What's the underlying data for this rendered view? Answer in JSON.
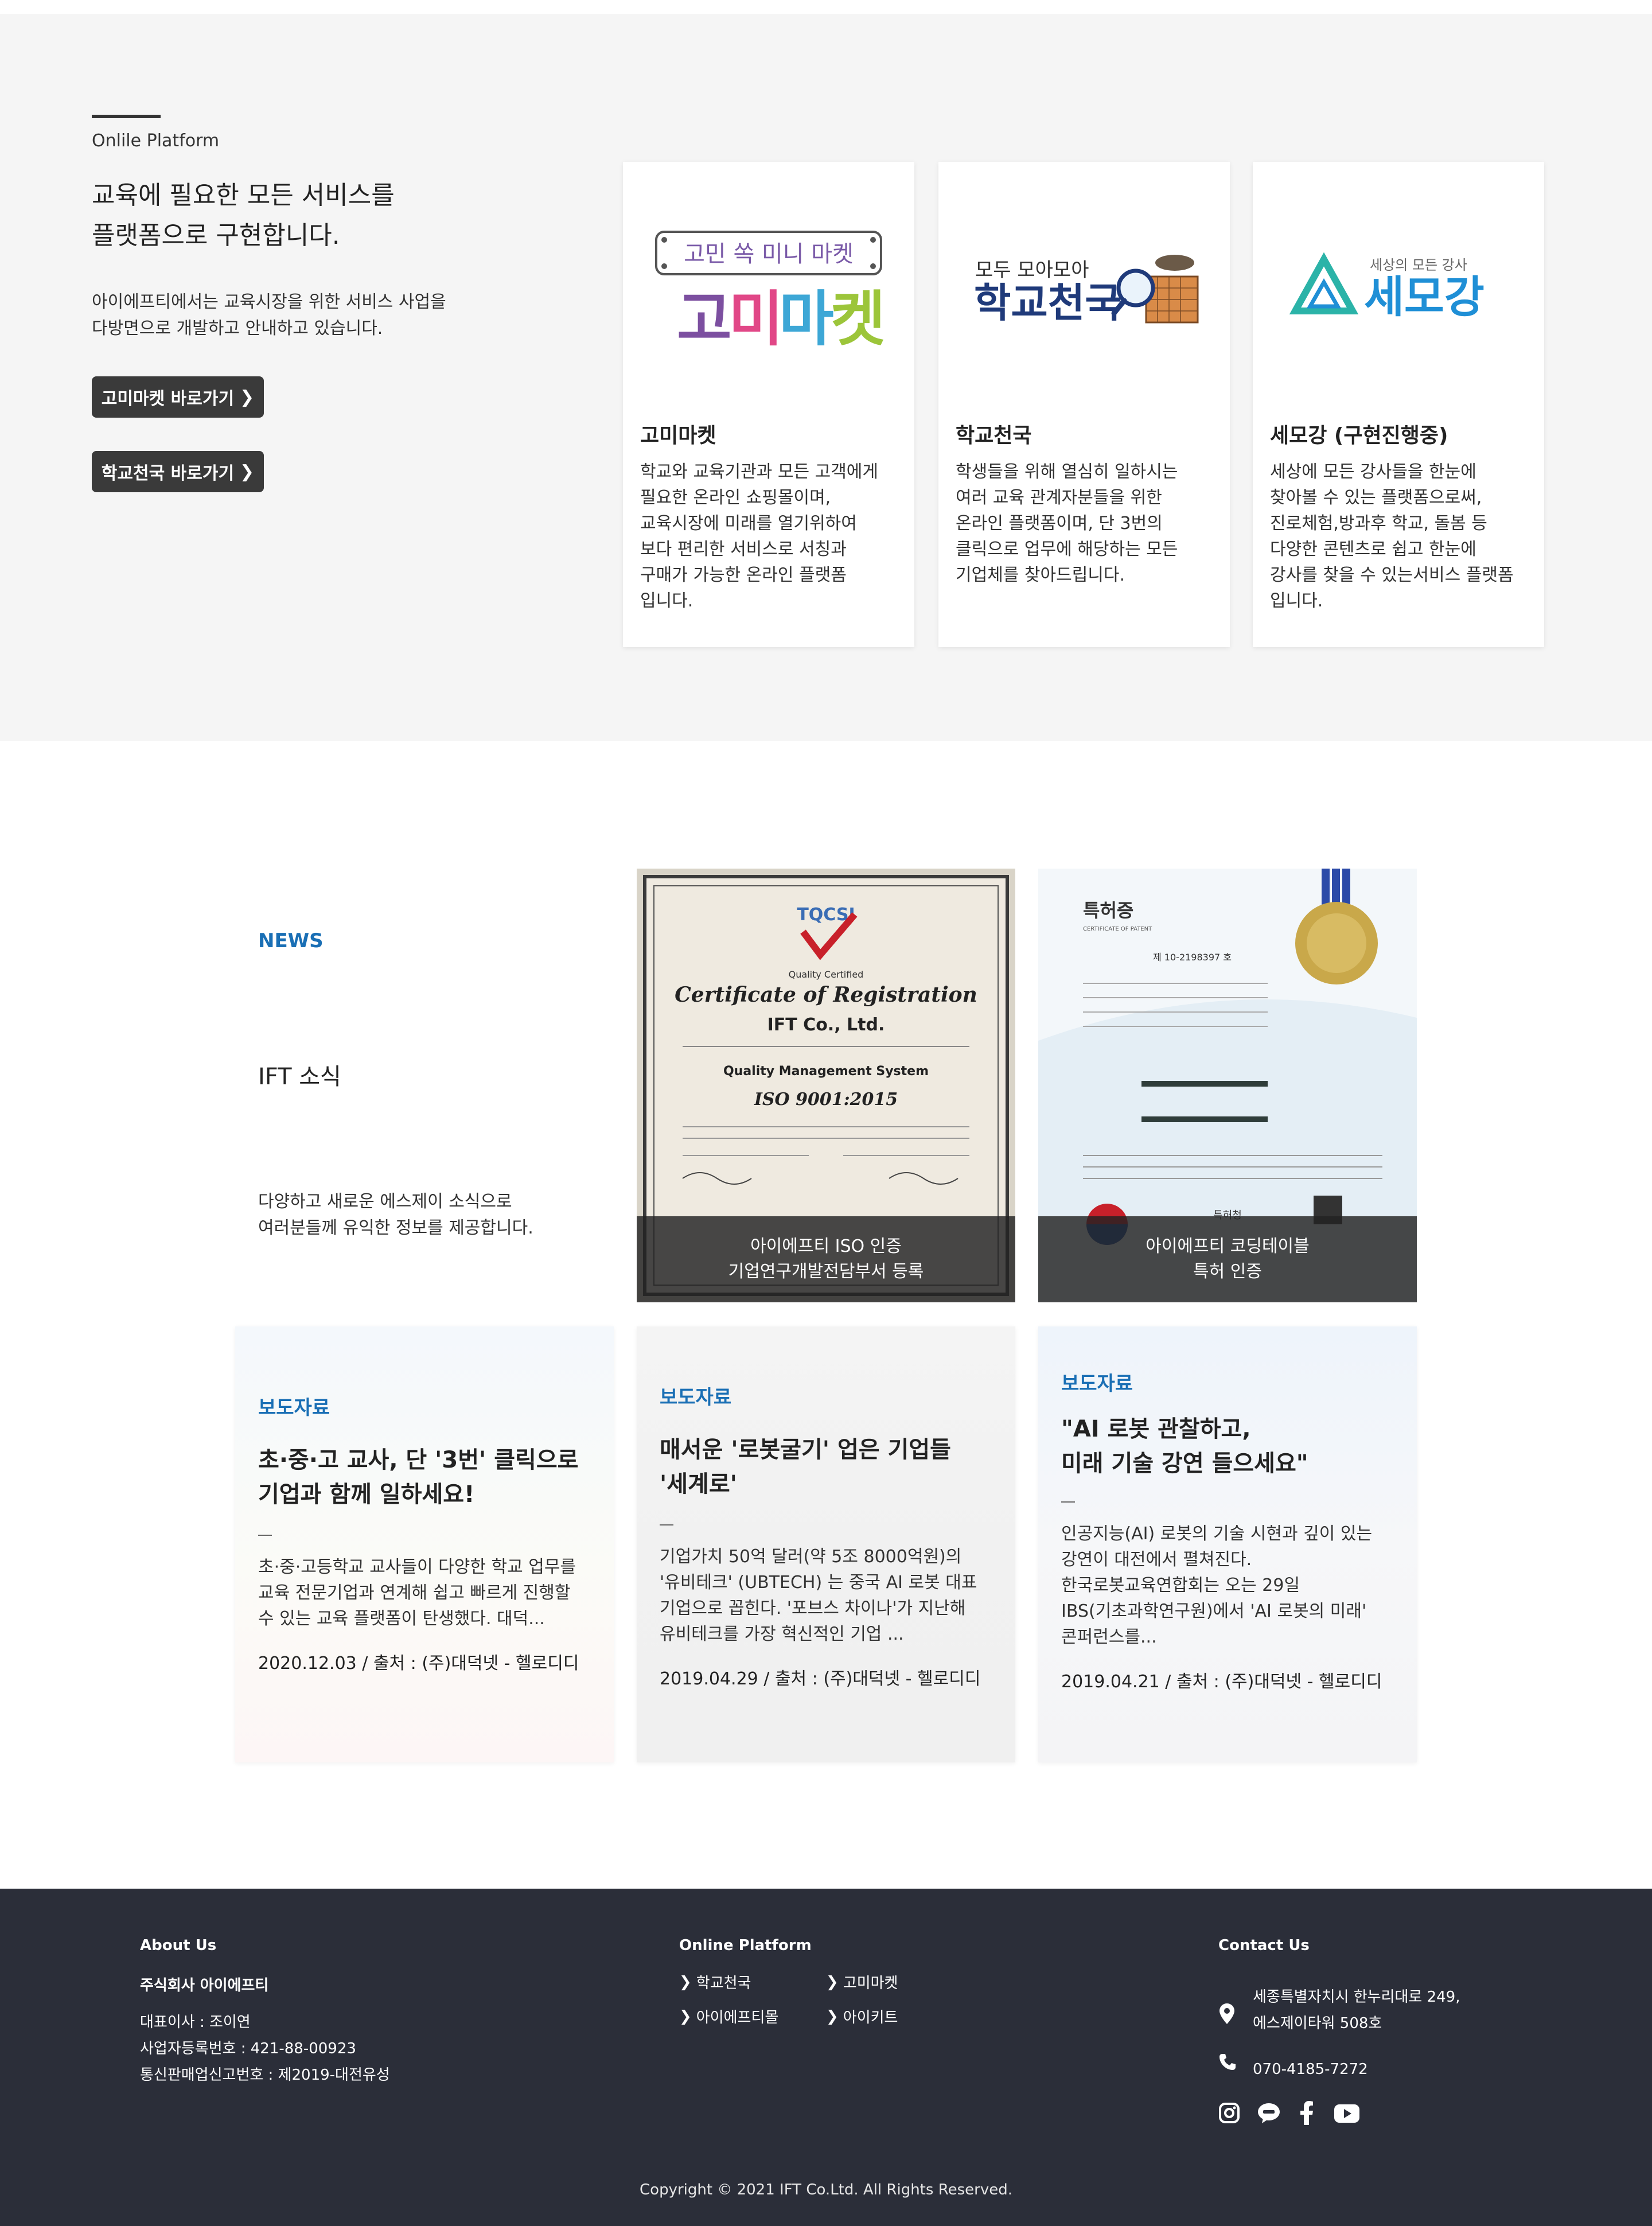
{
  "platform": {
    "eyebrow": "Onlile Platform",
    "title_line1": "교육에 필요한 모든 서비스를",
    "title_line2": "플랫폼으로 구현합니다.",
    "desc_line1": "아이에프티에서는 교육시장을 위한 서비스 사업을",
    "desc_line2": "다방면으로 개발하고 안내하고 있습니다.",
    "btn1_label": "고미마켓 바로가기",
    "btn2_label": "학교천국 바로가기",
    "cards": [
      {
        "logo_small": "고민 쏙 미니 마켓",
        "logo_chars": [
          "고",
          "미",
          "마",
          "켓"
        ],
        "title": "고미마켓",
        "desc": [
          "학교와 교육기관과 모든 고객에게",
          "필요한 온라인 쇼핑몰이며,",
          "교육시장에 미래를 열기위하여",
          "보다 편리한 서비스로 서칭과",
          "구매가 가능한 온라인 플랫폼",
          "입니다."
        ]
      },
      {
        "logo_small": "모두 모아모아",
        "logo_big": "학교천국",
        "title": "학교천국",
        "desc": [
          "학생들을 위해 열심히 일하시는",
          "여러 교육 관계자분들을 위한",
          "온라인 플랫폼이며, 단 3번의",
          "클릭으로 업무에 해당하는 모든",
          "기업체를 찾아드립니다."
        ]
      },
      {
        "logo_small": "세상의 모든 강사",
        "logo_big": "세모강",
        "title": "세모강 (구현진행중)",
        "desc": [
          "세상에 모든 강사들을 한눈에",
          "찾아볼 수 있는 플랫폼으로써,",
          "진로체험,방과후 학교, 돌봄 등",
          "다양한 콘텐츠로 쉽고 한눈에",
          "강사를 찾을 수 있는서비스 플랫폼",
          "입니다."
        ]
      }
    ]
  },
  "news": {
    "eyebrow": "NEWS",
    "title": "IFT 소식",
    "desc_line1": "다양하고 새로운 에스제이 소식으로",
    "desc_line2": "여러분들께 유익한 정보를 제공합니다.",
    "image_cards": [
      {
        "cert_brand": "TQCSI",
        "cert_sub": "Quality Certified",
        "cert_heading": "Certificate of Registration",
        "cert_company": "IFT Co., Ltd.",
        "cert_system": "Quality Management System",
        "cert_std": "ISO 9001:2015",
        "caption_line1": "아이에프티 ISO 인증",
        "caption_line2": "기업연구개발전담부서 등록"
      },
      {
        "cert_title": "특허증",
        "cert_sub": "CERTIFICATE OF PATENT",
        "cert_no": "제 10-2198397 호",
        "cert_office": "특허청",
        "caption_line1": "아이에프티 코딩테이블",
        "caption_line2": "특허 인증"
      }
    ],
    "press_cards": [
      {
        "category": "보도자료",
        "title": [
          "초·중·고 교사, 단 '3번' 클릭으로",
          "기업과 함께 일하세요!"
        ],
        "body": [
          "초·중·고등학교 교사들이 다양한 학교 업무를",
          "교육 전문기업과 연계해 쉽고 빠르게 진행할",
          "수 있는 교육 플랫폼이 탄생했다. 대덕..."
        ],
        "date": "2020.12.03 / 출처 : (주)대덕넷 - 헬로디디"
      },
      {
        "category": "보도자료",
        "title": [
          "매서운 '로봇굴기' 업은 기업들",
          "'세계로'"
        ],
        "body": [
          "기업가치 50억 달러(약 5조 8000억원)의",
          "'유비테크' (UBTECH) 는 중국 AI 로봇 대표",
          "기업으로 꼽힌다. '포브스 차이나'가 지난해",
          "유비테크를 가장 혁신적인 기업 ..."
        ],
        "date": "2019.04.29 / 출처 : (주)대덕넷 - 헬로디디"
      },
      {
        "category": "보도자료",
        "title": [
          "\"AI 로봇 관찰하고,",
          "미래 기술 강연 들으세요\""
        ],
        "body": [
          "인공지능(AI) 로봇의 기술 시현과 깊이 있는",
          "강연이 대전에서 펼쳐진다.",
          "한국로봇교육연합회는 오는 29일",
          "IBS(기초과학연구원)에서 'AI 로봇의 미래'",
          "콘퍼런스를..."
        ],
        "date": "2019.04.21 / 출처 : (주)대덕넷 - 헬로디디"
      }
    ]
  },
  "footer": {
    "about_heading": "About Us",
    "company": "주식회사 아이에프티",
    "ceo": "대표이사 : 조이연",
    "biz_no": "사업자등록번호 : 421-88-00923",
    "mail_order_no": "통신판매업신고번호 : 제2019-대전유성",
    "platform_heading": "Online Platform",
    "links": [
      "학교천국",
      "고미마켓",
      "아이에프티몰",
      "아이키트"
    ],
    "contact_heading": "Contact Us",
    "address_line1": "세종특별자치시 한누리대로 249,",
    "address_line2": "에스제이타워 508호",
    "phone": "070-4185-7272",
    "social": [
      "instagram-icon",
      "kakaotalk-icon",
      "facebook-icon",
      "youtube-icon"
    ],
    "copyright": "Copyright © 2021 IFT Co.Ltd. All Rights Reserved."
  }
}
